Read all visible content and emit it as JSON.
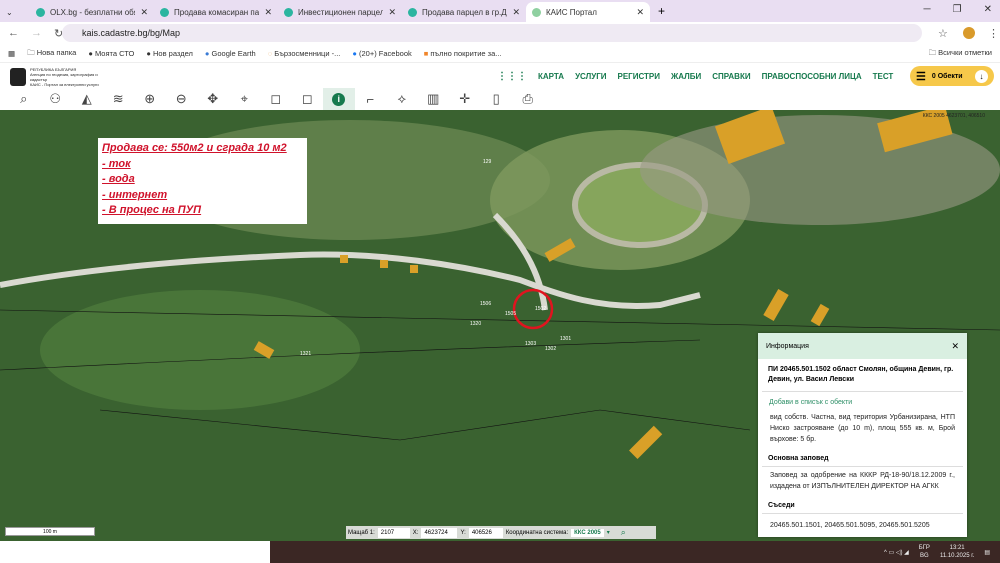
{
  "browser": {
    "tabs": [
      {
        "label": "OLX.bg - безплатни обяви"
      },
      {
        "label": "Продава комасиран парцел в..."
      },
      {
        "label": "Инвестиционен парцел в гр.Д..."
      },
      {
        "label": "Продава парцел в гр.Девин п..."
      },
      {
        "label": "КАИС Портал",
        "active": true
      }
    ],
    "url": "kais.cadastre.bg/bg/Map",
    "bookmarks": [
      "Нова папка",
      "Моята СТО",
      "Нов раздел",
      "Google Earth",
      "Бързосменници -...",
      "(20+) Facebook",
      "пълно покритие за..."
    ],
    "all_bookmarks": "Всички отметки"
  },
  "site": {
    "logo_text": "РЕПУБЛИКА БЪЛГАРИЯ · Агенция по геодезия, картография и кадастър · КАИС - Портал за електронни услуги",
    "nav": [
      "КАРТА",
      "УСЛУГИ",
      "РЕГИСТРИ",
      "ЖАЛБИ",
      "СПРАВКИ",
      "ПРАВОСПОСОБНИ ЛИЦА",
      "ТЕСТ"
    ],
    "objects_label": "0 Обекти"
  },
  "toolbar": [
    "search-icon",
    "network-icon",
    "layers-hat-icon",
    "layers-icon",
    "zoom-in-icon",
    "zoom-out-icon",
    "pan-icon",
    "pin-icon",
    "select-rect-icon",
    "deselect-rect-icon",
    "info-icon",
    "measure-line-icon",
    "measure-area-icon",
    "map-icon",
    "crosshair-icon",
    "document-icon",
    "print-icon"
  ],
  "map": {
    "ad_lines": [
      "Продава се:   550м2 и сграда 10 м2",
      "- ток",
      "- вода",
      "- интернет",
      "- В процес на ПУП"
    ],
    "corner_coords": "ККС 2005 4623701, 406510",
    "scale_label": "100 m",
    "parcel_labels": [
      "129",
      "1506",
      "1502",
      "1505",
      "1320",
      "1321",
      "1303",
      "1302",
      "1301"
    ],
    "coordbar": {
      "scale_label": "Мащаб 1:",
      "scale": "2107",
      "x_label": "X:",
      "x": "4623724",
      "y_label": "Y:",
      "y": "406526",
      "system_label": "Координатна система:",
      "system": "ККС 2005"
    }
  },
  "info_panel": {
    "title": "Информация",
    "parcel": "ПИ 20465.501.1502 област Смолян, община Девин, гр. Девин, ул. Васил Левски",
    "add_link": "Добави в списък с обекти",
    "details": "вид собств. Частна, вид територия Урбанизирана, НТП Ниско застрояване (до 10 m), площ 555 кв. м, Брой върхове: 5 бр.",
    "order_heading": "Основна заповед",
    "order": "Заповед за одобрение на КККР РД-18-90/18.12.2009 г., издадена от ИЗПЪЛНИТЕЛЕН ДИРЕКТОР НА АГКК",
    "neighbors_heading": "Съседи",
    "neighbors": "20465.501.1501, 20465.501.5095, 20465.501.5205"
  },
  "taskbar": {
    "lang1": "БГР",
    "lang2": "BG",
    "time": "13:21",
    "date": "11.10.2025 г."
  }
}
